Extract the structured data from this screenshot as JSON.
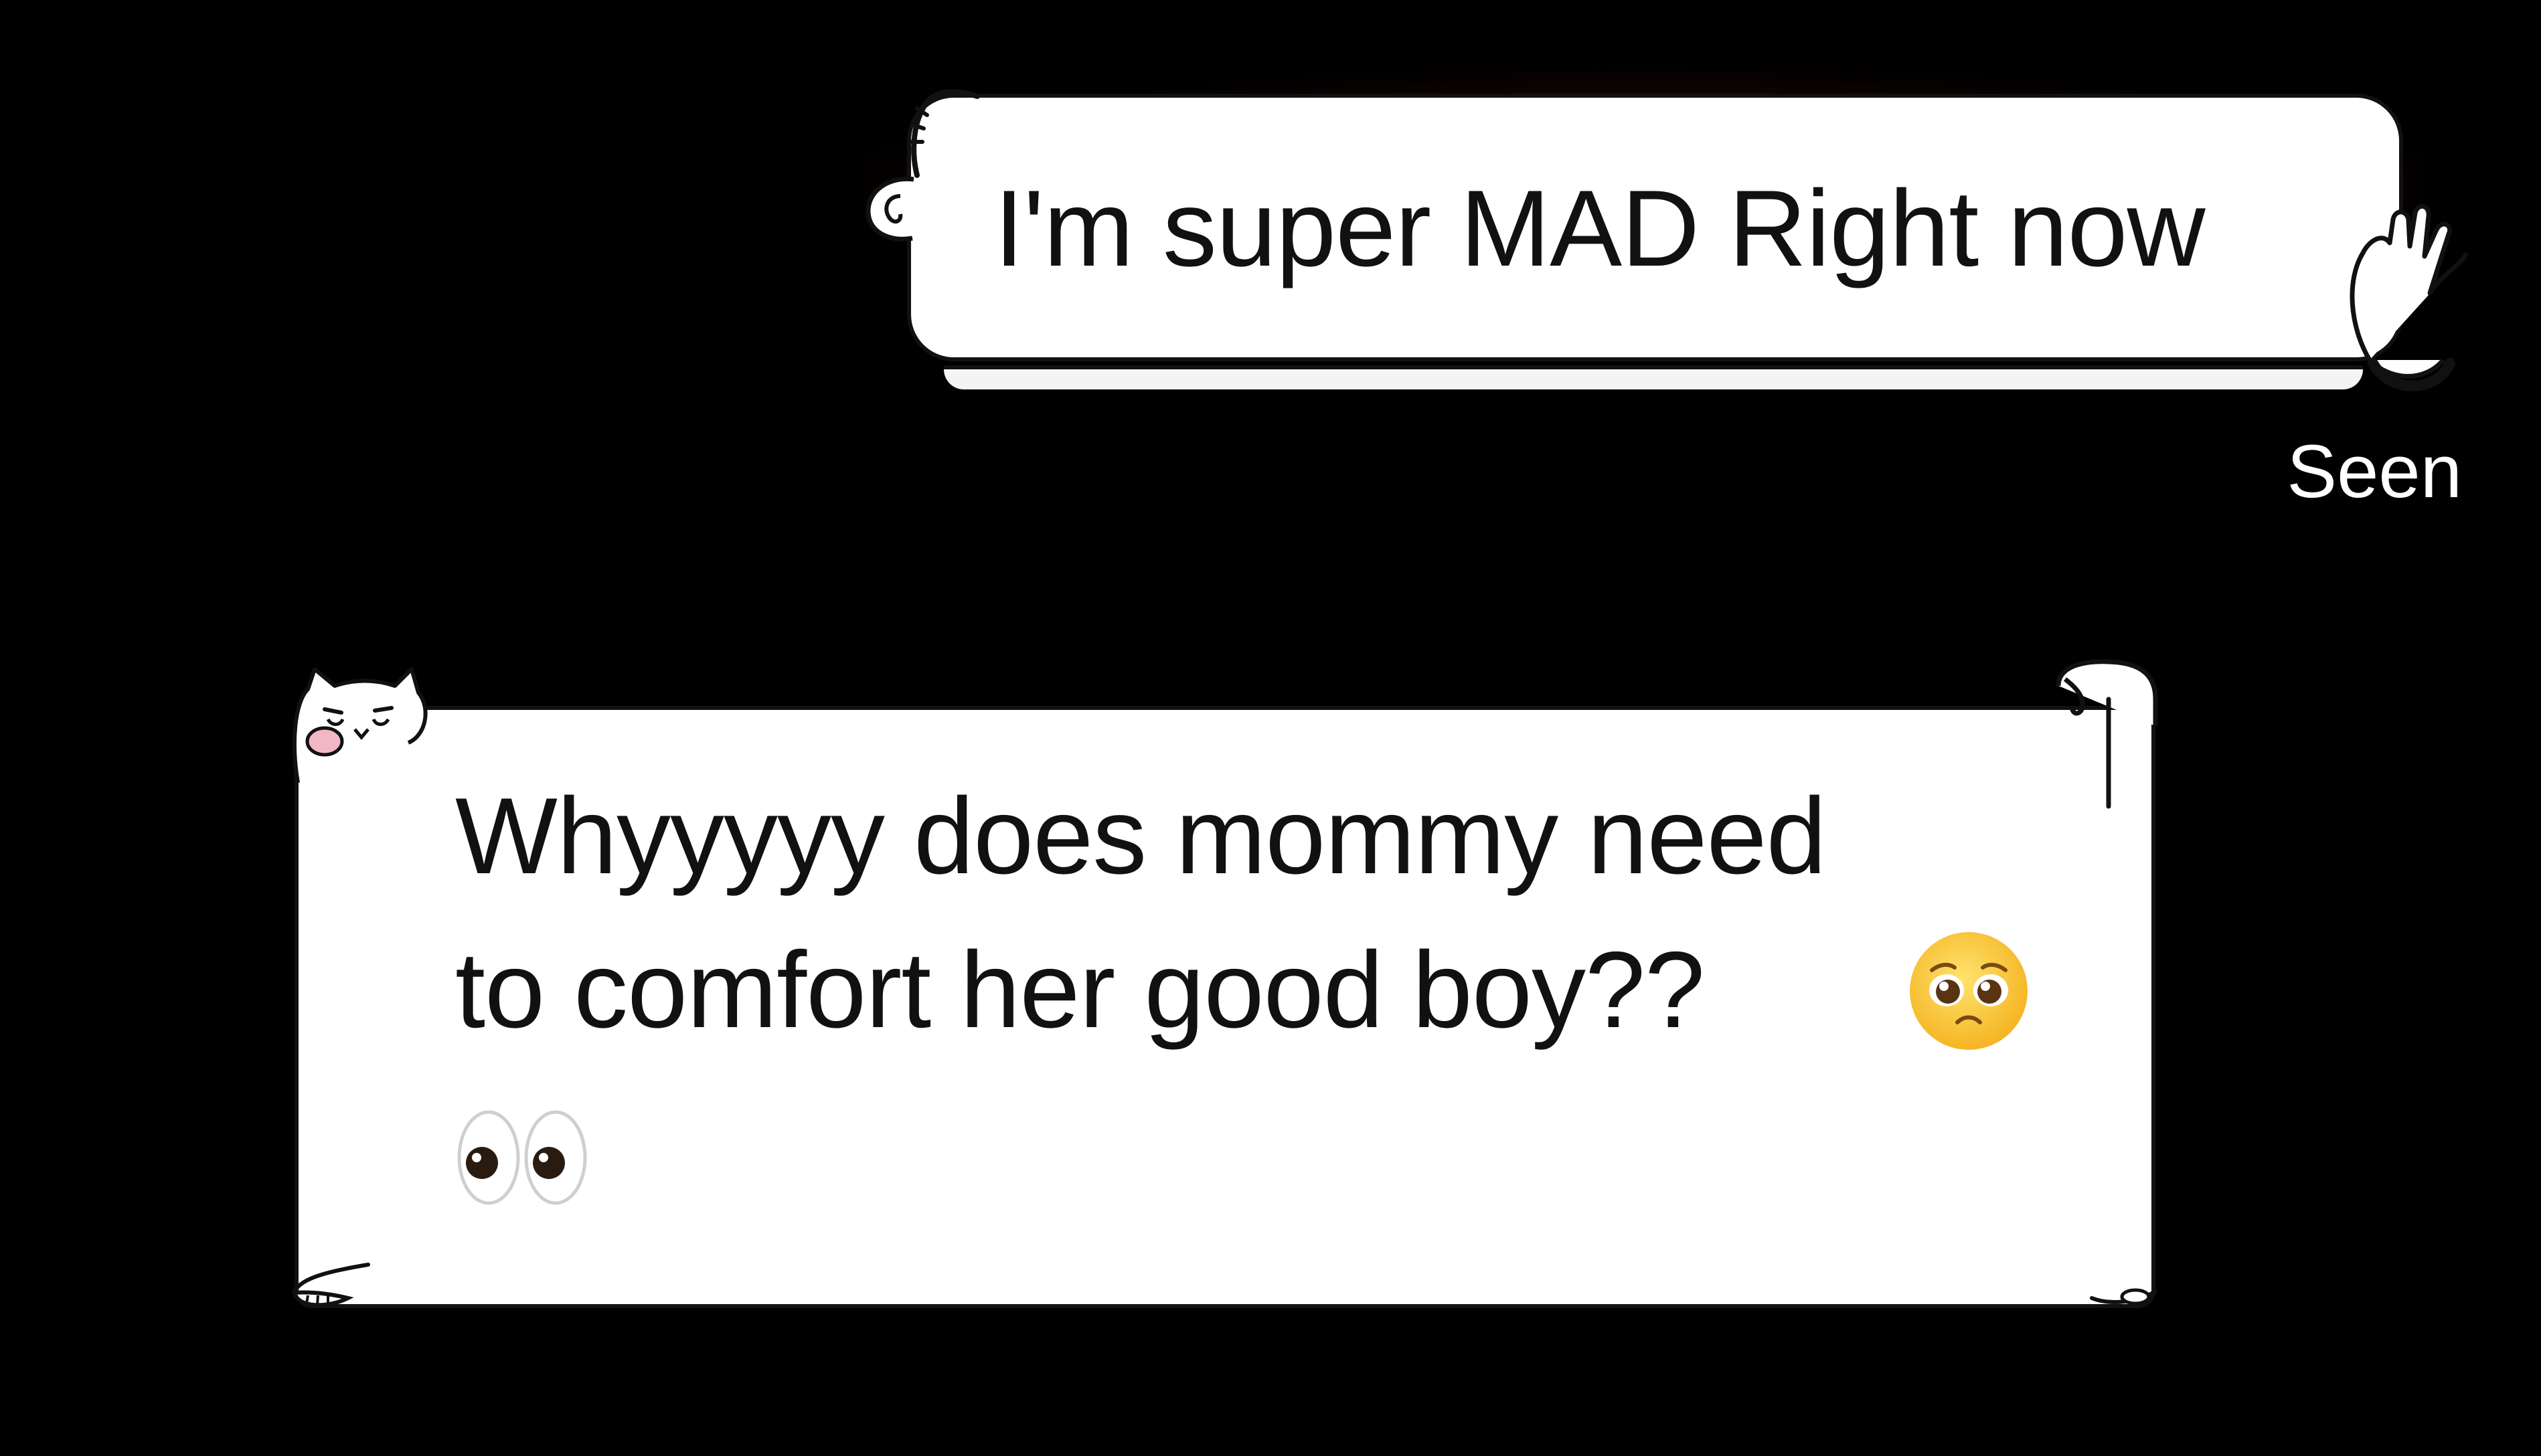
{
  "conversation": {
    "sent_message": {
      "text": "I'm super MAD Right now",
      "status": "Seen"
    },
    "received_message": {
      "line1": "Whyyyyy does mommy need",
      "line2": "to comfort her good boy??",
      "emoji_pleading": "🥺",
      "emoji_eyes": "👀"
    }
  },
  "colors": {
    "background": "#000000",
    "bubble": "#ffffff",
    "text": "#111111",
    "status_text": "#ffffff"
  },
  "icons": [
    "ear-doodle-icon",
    "waving-hand-doodle-icon",
    "cat-doodle-icon",
    "arm-doodle-icon",
    "pleading-face-emoji-icon",
    "eyes-emoji-icon"
  ]
}
